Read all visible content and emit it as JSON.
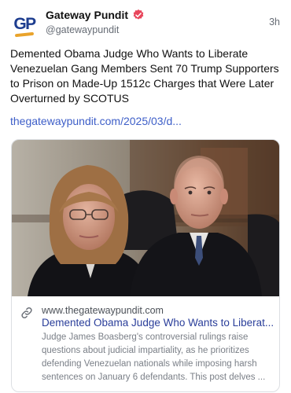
{
  "post": {
    "author": {
      "display_name": "Gateway Pundit",
      "handle": "@gatewaypundit",
      "avatar_text": "GP",
      "verified": true,
      "verified_color": "#e8455b"
    },
    "time": "3h",
    "text": "Demented Obama Judge Who Wants to Liberate Venezuelan Gang Members Sent 70 Trump Supporters to Prison on Made-Up 1512c Charges that Were Later Overturned by SCOTUS",
    "link_text": "thegatewaypundit.com/2025/03/d...",
    "link_color": "#3d5ec8"
  },
  "card": {
    "image_description": "photo",
    "link_icon": "link-icon",
    "domain": "www.thegatewaypundit.com",
    "title": "Demented Obama Judge Who Wants to Liberat...",
    "description": "Judge James Boasberg's controversial rulings raise questions about judicial impartiality, as he prioritizes defending Venezuelan nationals while imposing harsh sentences on January 6 defendants. This post delves ..."
  }
}
